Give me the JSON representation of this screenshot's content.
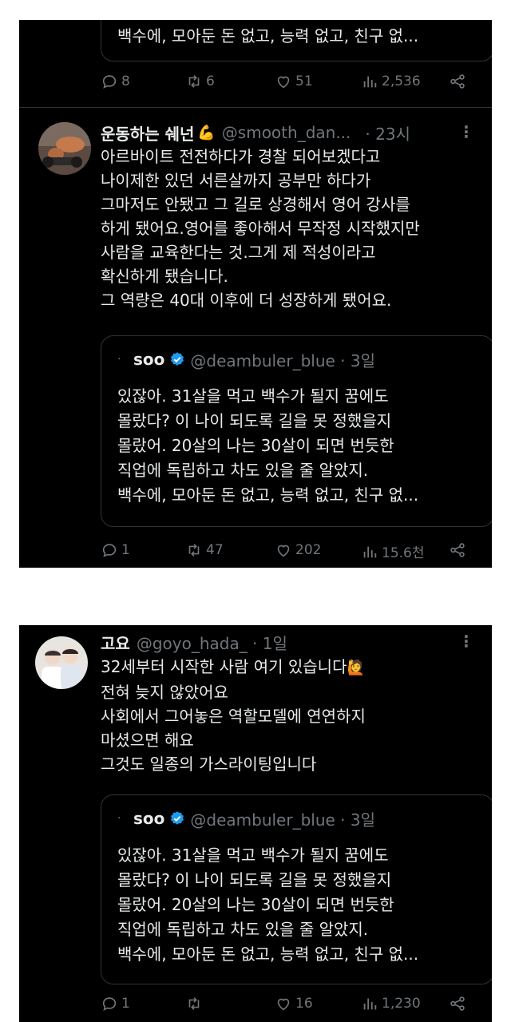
{
  "colors": {
    "text": "#e7e9ea",
    "secondary": "#71767b",
    "border": "#2f3336",
    "verified": "#1d9bf0",
    "background": "#000000"
  },
  "top_quote_tail": "백수에, 모아둔 돈 없고, 능력 없고, 친구 없...",
  "top_actions": {
    "replies": "8",
    "retweets": "6",
    "likes": "51",
    "views": "2,536"
  },
  "tweet1": {
    "name": "운동하는 쉐넌",
    "emoji": "💪",
    "handle": "@smooth_dan...",
    "time": "· 23시",
    "more": "⋮",
    "lines": [
      "아르바이트 전전하다가 경찰 되어보겠다고",
      "나이제한 있던 서른살까지 공부만 하다가",
      "그마저도 안됐고 그 길로 상경해서 영어 강사를",
      "하게 됐어요.영어를 좋아해서 무작정 시작했지만",
      "사람을 교육한다는 것.그게 제 적성이라고",
      "확신하게 됐습니다.",
      "그 역량은 40대 이후에 더 성장하게 됐어요."
    ],
    "quote": {
      "dot": "·",
      "name": "soo",
      "handle": "@deambuler_blue · 3일",
      "lines": [
        "있잖아. 31살을 먹고 백수가 될지 꿈에도",
        "몰랐다? 이 나이 되도록 길을 못 정했을지",
        "몰랐어. 20살의 나는 30살이 되면 번듯한",
        "직업에 독립하고 차도 있을 줄 알았지.",
        "백수에, 모아둔 돈 없고, 능력 없고, 친구 없..."
      ]
    },
    "actions": {
      "replies": "1",
      "retweets": "47",
      "likes": "202",
      "views": "15.6천"
    }
  },
  "tweet2": {
    "name": "고요",
    "handle": "@goyo_hada_ · 1일",
    "more": "⋮",
    "lines": [
      "32세부터 시작한 사람 여기 있습니다",
      "전혀 늦지 않았어요",
      "사회에서 그어놓은 역할모델에 연연하지",
      "마셨으면 해요",
      "그것도 일종의 가스라이팅입니다"
    ],
    "emoji": "🙋",
    "quote": {
      "dot": "·",
      "name": "soo",
      "handle": "@deambuler_blue · 3일",
      "lines": [
        "있잖아. 31살을 먹고 백수가 될지 꿈에도",
        "몰랐다? 이 나이 되도록 길을 못 정했을지",
        "몰랐어. 20살의 나는 30살이 되면 번듯한",
        "직업에 독립하고 차도 있을 줄 알았지.",
        "백수에, 모아둔 돈 없고, 능력 없고, 친구 없..."
      ]
    },
    "actions": {
      "replies": "1",
      "retweets": "",
      "likes": "16",
      "views": "1,230"
    }
  }
}
